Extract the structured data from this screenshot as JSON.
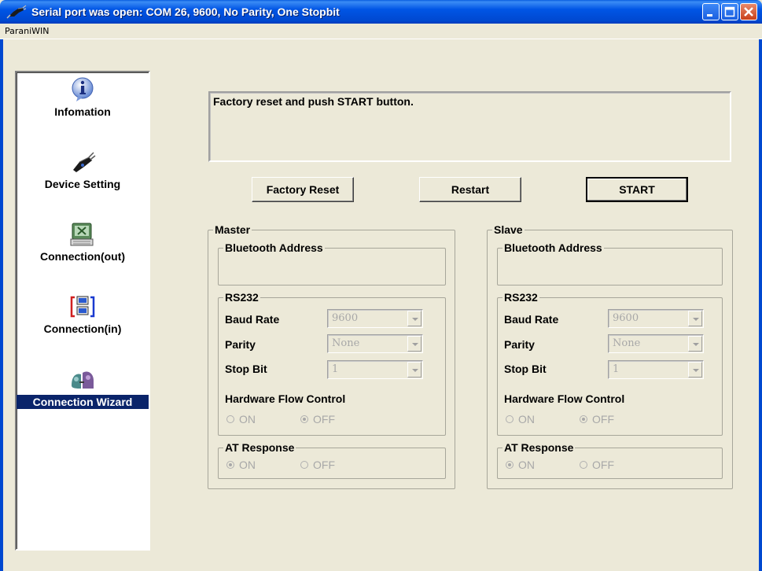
{
  "window": {
    "title": "Serial port was open: COM 26, 9600, No Parity, One Stopbit",
    "menu": [
      "ParaniWIN"
    ]
  },
  "sidebar": {
    "items": [
      {
        "label": "Infomation",
        "icon": "info-icon"
      },
      {
        "label": "Device Setting",
        "icon": "device-icon"
      },
      {
        "label": "Connection(out)",
        "icon": "connection-out-icon"
      },
      {
        "label": "Connection(in)",
        "icon": "connection-in-icon"
      },
      {
        "label": "Connection Wizard",
        "icon": "wizard-icon",
        "selected": true
      }
    ]
  },
  "message": "Factory reset and push START button.",
  "buttons": {
    "factory_reset": "Factory Reset",
    "restart": "Restart",
    "start": "START"
  },
  "master": {
    "title": "Master",
    "bt_title": "Bluetooth Address",
    "bt_value": "",
    "rs232_title": "RS232",
    "baud_label": "Baud Rate",
    "baud_value": "9600",
    "parity_label": "Parity",
    "parity_value": "None",
    "stop_label": "Stop Bit",
    "stop_value": "1",
    "hfc_label": "Hardware Flow Control",
    "hfc_on": "ON",
    "hfc_off": "OFF",
    "hfc_selected": "OFF",
    "at_title": "AT Response",
    "at_on": "ON",
    "at_off": "OFF",
    "at_selected": "ON"
  },
  "slave": {
    "title": "Slave",
    "bt_title": "Bluetooth Address",
    "bt_value": "",
    "rs232_title": "RS232",
    "baud_label": "Baud Rate",
    "baud_value": "9600",
    "parity_label": "Parity",
    "parity_value": "None",
    "stop_label": "Stop Bit",
    "stop_value": "1",
    "hfc_label": "Hardware Flow Control",
    "hfc_on": "ON",
    "hfc_off": "OFF",
    "hfc_selected": "OFF",
    "at_title": "AT Response",
    "at_on": "ON",
    "at_off": "OFF",
    "at_selected": "ON"
  },
  "colors": {
    "titlebar": "#0055e5",
    "background": "#ece9d8",
    "selection": "#0a246a"
  }
}
